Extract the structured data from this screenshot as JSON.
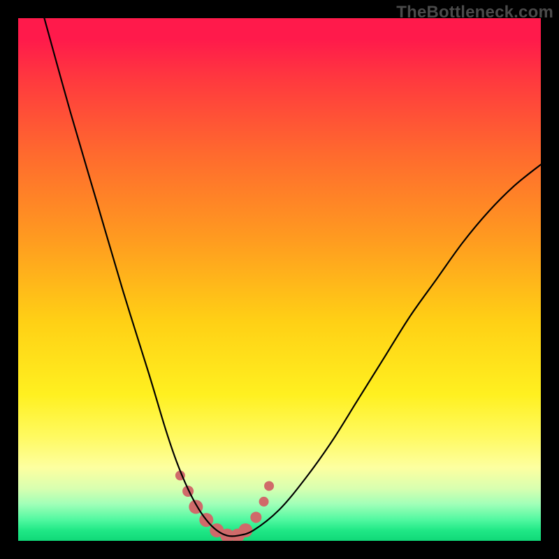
{
  "watermark": "TheBottleneck.com",
  "chart_data": {
    "type": "line",
    "title": "",
    "xlabel": "",
    "ylabel": "",
    "xlim": [
      0,
      100
    ],
    "ylim": [
      0,
      100
    ],
    "grid": false,
    "legend": false,
    "series": [
      {
        "name": "bottleneck-curve",
        "x": [
          5,
          10,
          15,
          20,
          25,
          28,
          30,
          32,
          34,
          36,
          38,
          40,
          42,
          45,
          50,
          55,
          60,
          65,
          70,
          75,
          80,
          85,
          90,
          95,
          100
        ],
        "values": [
          100,
          82,
          65,
          48,
          32,
          22,
          16,
          11,
          7,
          4,
          2,
          1,
          1,
          2,
          6,
          12,
          19,
          27,
          35,
          43,
          50,
          57,
          63,
          68,
          72
        ]
      }
    ],
    "markers": {
      "name": "highlight-dots",
      "x": [
        31,
        32.5,
        34,
        36,
        38,
        40,
        42,
        43.5,
        45.5,
        47,
        48
      ],
      "values": [
        12.5,
        9.5,
        6.5,
        4,
        2,
        1,
        1,
        2,
        4.5,
        7.5,
        10.5
      ],
      "radius": [
        7,
        8,
        10,
        10,
        10,
        10,
        10,
        10,
        8,
        7,
        7
      ]
    },
    "colors": {
      "curve": "#000000",
      "markers": "#d06a6a",
      "gradient_top": "#ff1a4b",
      "gradient_mid": "#fff020",
      "gradient_bottom": "#20e886"
    }
  }
}
